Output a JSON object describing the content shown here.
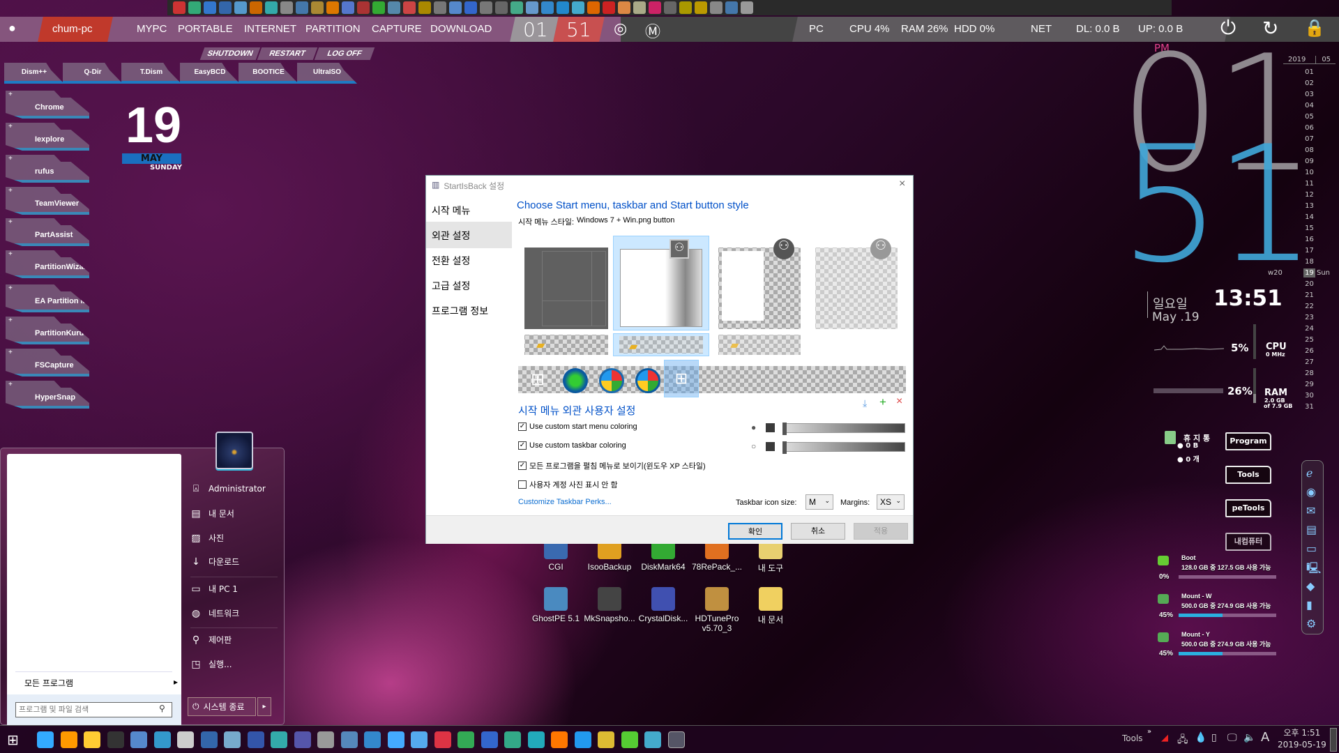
{
  "top_strip_icons": [
    "#c33",
    "#3a7",
    "#37c",
    "#36a",
    "#59c",
    "#c60",
    "#3aa",
    "#888",
    "#47a",
    "#a83",
    "#d70",
    "#57c",
    "#a33",
    "#3a3",
    "#58a",
    "#c44",
    "#a80",
    "#777",
    "#58c",
    "#36c",
    "#777",
    "#666",
    "#4a8",
    "#69c",
    "#38c",
    "#28c",
    "#4ac",
    "#d60",
    "#c22",
    "#d84",
    "#aa8",
    "#c26",
    "#666",
    "#a90",
    "#b90",
    "#888",
    "#47a",
    "#999"
  ],
  "topbar": {
    "host": "chum-pc",
    "menu": [
      "MYPC",
      "PORTABLE",
      "INTERNET",
      "PARTITION",
      "CAPTURE",
      "DOWNLOAD"
    ],
    "hour": "01",
    "minute": "51",
    "pc": "PC",
    "cpu": "CPU 4%",
    "ram": "RAM 26%",
    "hdd": "HDD 0%",
    "net": "NET",
    "dl": "DL: 0.0 B",
    "up": "UP: 0.0 B"
  },
  "power_row": [
    "SHUTDOWN",
    "RESTART",
    "LOG OFF"
  ],
  "top_launchers": [
    "Dism++",
    "Q-Dir",
    "T.Dism",
    "EasyBCD",
    "BOOTICE",
    "UltraISO"
  ],
  "left_launchers": [
    "Chrome",
    "Iexplore",
    "rufus",
    "TeamViewer",
    "PartAssist",
    "PartitionWizard",
    "EA Partition M",
    "PartitionKuru",
    "FSCapture",
    "HyperSnap"
  ],
  "date_widget": {
    "day": "19",
    "month": "MAY",
    "weekday": "SUNDAY"
  },
  "start_menu": {
    "items": [
      {
        "label": "Administrator",
        "icon": "user-folder-icon"
      },
      {
        "label": "내 문서",
        "icon": "document-icon"
      },
      {
        "label": "사진",
        "icon": "picture-icon"
      },
      {
        "label": "다운로드",
        "icon": "download-icon"
      },
      {
        "label": "내 PC 1",
        "icon": "computer-icon"
      },
      {
        "label": "네트워크",
        "icon": "network-icon"
      },
      {
        "label": "제어판",
        "icon": "wrench-icon"
      },
      {
        "label": "실행...",
        "icon": "run-icon"
      }
    ],
    "all_programs": "모든 프로그램",
    "search_placeholder": "프로그램 및 파일 검색",
    "shutdown": "시스템 종료"
  },
  "dialog": {
    "title": "StartIsBack 설정",
    "nav": [
      "시작 메뉴",
      "외관 설정",
      "전환 설정",
      "고급 설정",
      "프로그램 정보"
    ],
    "nav_selected": 1,
    "heading": "Choose Start menu, taskbar and Start button style",
    "style_label": "시작 메뉴 스타일:",
    "style_value": "Windows 7 + Win.png button",
    "custom_heading": "시작 메뉴 외관 사용자 설정",
    "checkboxes": [
      {
        "label": "Use custom start menu coloring",
        "checked": true
      },
      {
        "label": "Use custom taskbar coloring",
        "checked": true
      },
      {
        "label": "모든 프로그램을 펼침 메뉴로 보이기(윈도우 XP 스타일)",
        "checked": true
      },
      {
        "label": "사용자 계정 사진 표시 안 함",
        "checked": false
      }
    ],
    "link": "Customize Taskbar Perks...",
    "icon_size_label": "Taskbar icon size:",
    "icon_size": "M",
    "margins_label": "Margins:",
    "margins": "XS",
    "ok": "확인",
    "cancel": "취소",
    "apply": "적용",
    "accent": "#0050c8"
  },
  "desktop_icons": [
    {
      "label": "CGI",
      "color": "#3a6ab0"
    },
    {
      "label": "IsooBackup",
      "color": "#e0a020"
    },
    {
      "label": "DiskMark64",
      "color": "#3a3"
    },
    {
      "label": "78RePack_...",
      "color": "#e07020"
    },
    {
      "label": "내 도구",
      "color": "#e8d070"
    },
    {
      "label": "GhostPE 5.1",
      "color": "#4a8ac0"
    },
    {
      "label": "MkSnapsho...",
      "color": "#444"
    },
    {
      "label": "CrystalDisk...",
      "color": "#4050b0"
    },
    {
      "label": "HDTunePro\nv5.70_3",
      "color": "#c09040"
    },
    {
      "label": "내 문서",
      "color": "#f0d060"
    }
  ],
  "clock_widget": {
    "ampm": "PM",
    "hour": "01",
    "minute": "51",
    "weekday": "일요일",
    "date": "May .19",
    "time": "13:51"
  },
  "calendar": {
    "year": "2019",
    "month": "05",
    "week": "w20",
    "today": "19",
    "today_day": "Sun",
    "days": [
      "01",
      "02",
      "03",
      "04",
      "05",
      "06",
      "07",
      "08",
      "09",
      "10",
      "11",
      "12",
      "13",
      "14",
      "15",
      "16",
      "17",
      "18",
      "19",
      "20",
      "21",
      "22",
      "23",
      "24",
      "25",
      "26",
      "27",
      "28",
      "29",
      "30",
      "31"
    ]
  },
  "sysmon": {
    "cpu_pct": "5%",
    "cpu_label": "CPU",
    "cpu_mhz": "0 MHz",
    "ram_pct": "26%",
    "ram_label": "RAM",
    "ram_used": "2.0 GB",
    "ram_total": "of 7.9 GB"
  },
  "recycle": {
    "label": "휴 지 통",
    "size": "0 B",
    "count": "0 개"
  },
  "folder_buttons": [
    "Program",
    "Tools",
    "peTools",
    "내컴퓨터"
  ],
  "drives": [
    {
      "name": "Boot",
      "info": "128.0 GB 중 127.5 GB 사용 가능",
      "pct": "0%",
      "fill": 0
    },
    {
      "name": "Mount - W",
      "info": "500.0 GB 중 274.9 GB 사용 가능",
      "pct": "45%",
      "fill": 45
    },
    {
      "name": "Mount - Y",
      "info": "500.0 GB 중 274.9 GB 사용 가능",
      "pct": "45%",
      "fill": 45
    }
  ],
  "dock_icons": [
    "ie-icon",
    "chrome-icon",
    "mail-icon",
    "app-icon",
    "window-icon",
    "computer-icon",
    "disk-icon",
    "book-icon",
    "network-icon"
  ],
  "taskbar": {
    "icons": [
      "#3af",
      "#f90",
      "#fc3",
      "#333",
      "#58c",
      "#39c",
      "#ccc",
      "#36a",
      "#7ac",
      "#35a",
      "#3aa",
      "#55a",
      "#999",
      "#58b",
      "#38c",
      "#4af",
      "#5ae",
      "#d34",
      "#3a5",
      "#36c",
      "#3a8",
      "#2ab",
      "#f70",
      "#29e",
      "#db3",
      "#5c3",
      "#4ac",
      "#bbb"
    ],
    "tools": "Tools",
    "ampm_time": "오후 1:51",
    "date": "2019-05-19"
  }
}
